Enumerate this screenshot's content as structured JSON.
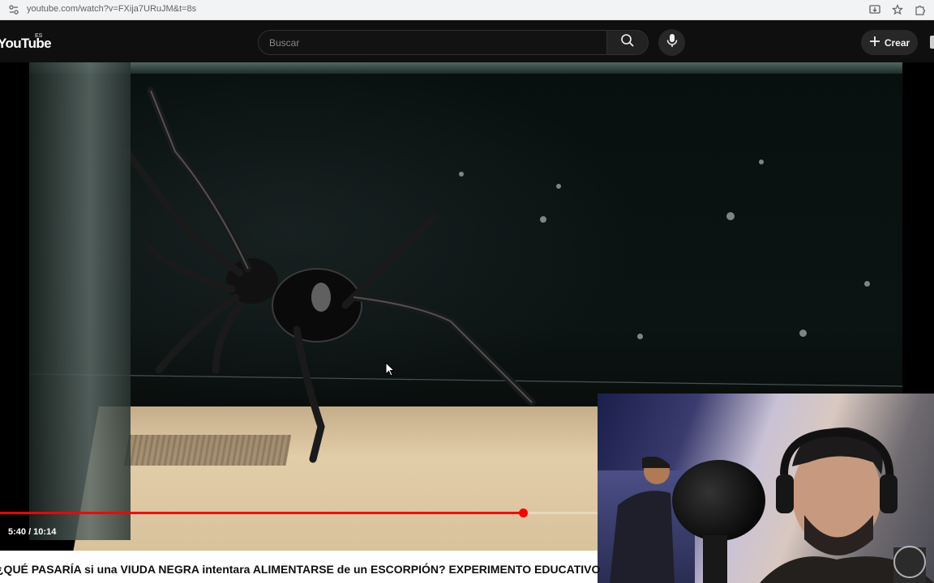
{
  "browser": {
    "url": "youtube.com/watch?v=FXija7URuJM&t=8s"
  },
  "masthead": {
    "logo_text": "YouTube",
    "logo_region": "ES",
    "search_placeholder": "Buscar",
    "create_label": "Crear"
  },
  "player": {
    "current_time": "5:40",
    "duration": "10:14",
    "time_display": "5:40 / 10:14",
    "progress_fraction": 0.5537
  },
  "video": {
    "title": "¿QUÉ PASARÍA si una VIUDA NEGRA intentara ALIMENTARSE de un ESCORPIÓN? EXPERIMENTO EDUCATIVO"
  },
  "colors": {
    "accent": "#ff0000",
    "masthead_bg": "#0f0f0f"
  },
  "icons": [
    "site-info-icon",
    "install-icon",
    "star-icon",
    "extensions-icon",
    "search-icon",
    "mic-icon",
    "plus-icon",
    "cursor-icon"
  ]
}
